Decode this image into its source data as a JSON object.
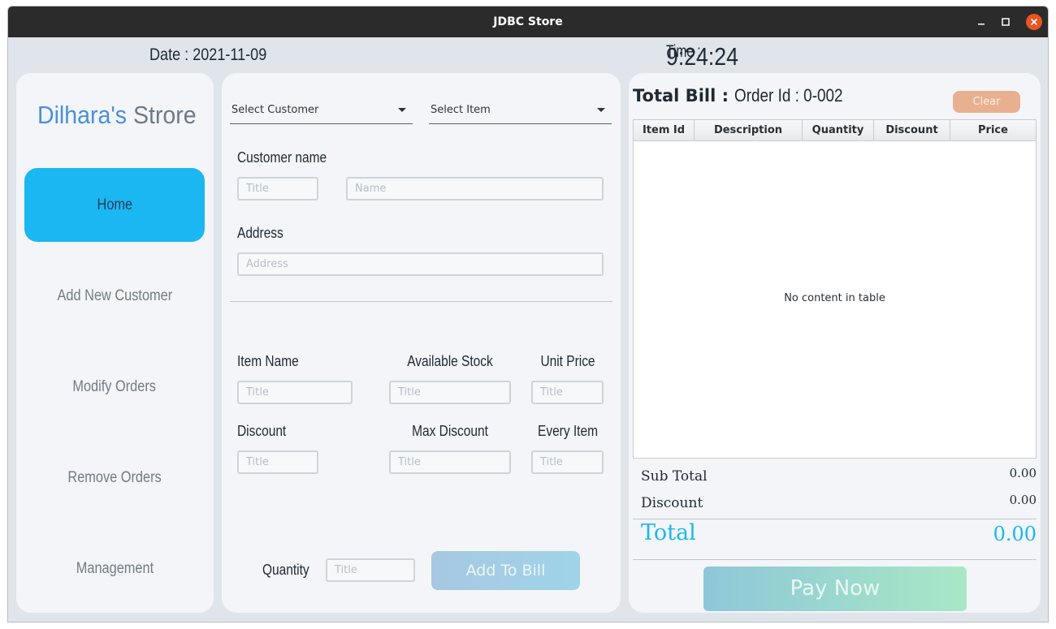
{
  "window": {
    "title": "JDBC Store"
  },
  "header": {
    "date_text": "Date : 2021-11-09",
    "time_label": "Time : ",
    "time_value": "9:24:24"
  },
  "brand": {
    "part1": "Dilhara's",
    "part2": " Strore"
  },
  "nav": {
    "items": [
      {
        "label": "Home",
        "active": true
      },
      {
        "label": "Add New Customer",
        "active": false
      },
      {
        "label": "Modify Orders",
        "active": false
      },
      {
        "label": "Remove Orders",
        "active": false
      },
      {
        "label": "Management",
        "active": false
      }
    ]
  },
  "form": {
    "customer_combo": "Select Customer",
    "item_combo": "Select Item",
    "customer_name_label": "Customer name",
    "title_placeholder": "Title",
    "name_placeholder": "Name",
    "address_label": "Address",
    "address_placeholder": "Address",
    "item_name_label": "Item Name",
    "available_stock_label": "Available Stock",
    "unit_price_label": "Unit Price",
    "discount_label": "Discount",
    "max_discount_label": "Max Discount",
    "every_item_label": "Every Item",
    "quantity_label": "Quantity",
    "add_button": "Add To Bill"
  },
  "bill": {
    "title": "Total Bill : ",
    "order_id": "Order Id : 0-002",
    "clear_button": "Clear",
    "columns": [
      "Item Id",
      "Description",
      "Quantity",
      "Discount",
      "Price"
    ],
    "rows": [],
    "empty_text": "No content in table",
    "sub_total_label": "Sub Total",
    "sub_total_value": "0.00",
    "discount_label": "Discount",
    "discount_value": "0.00",
    "total_label": "Total",
    "total_value": "0.00",
    "pay_button": "Pay Now"
  },
  "colors": {
    "accent": "#1bb7f2",
    "brand_blue": "#4a90d9",
    "clear_button": "#e9b08f",
    "titlebar": "#2b2b2b",
    "close_button": "#e95420"
  }
}
